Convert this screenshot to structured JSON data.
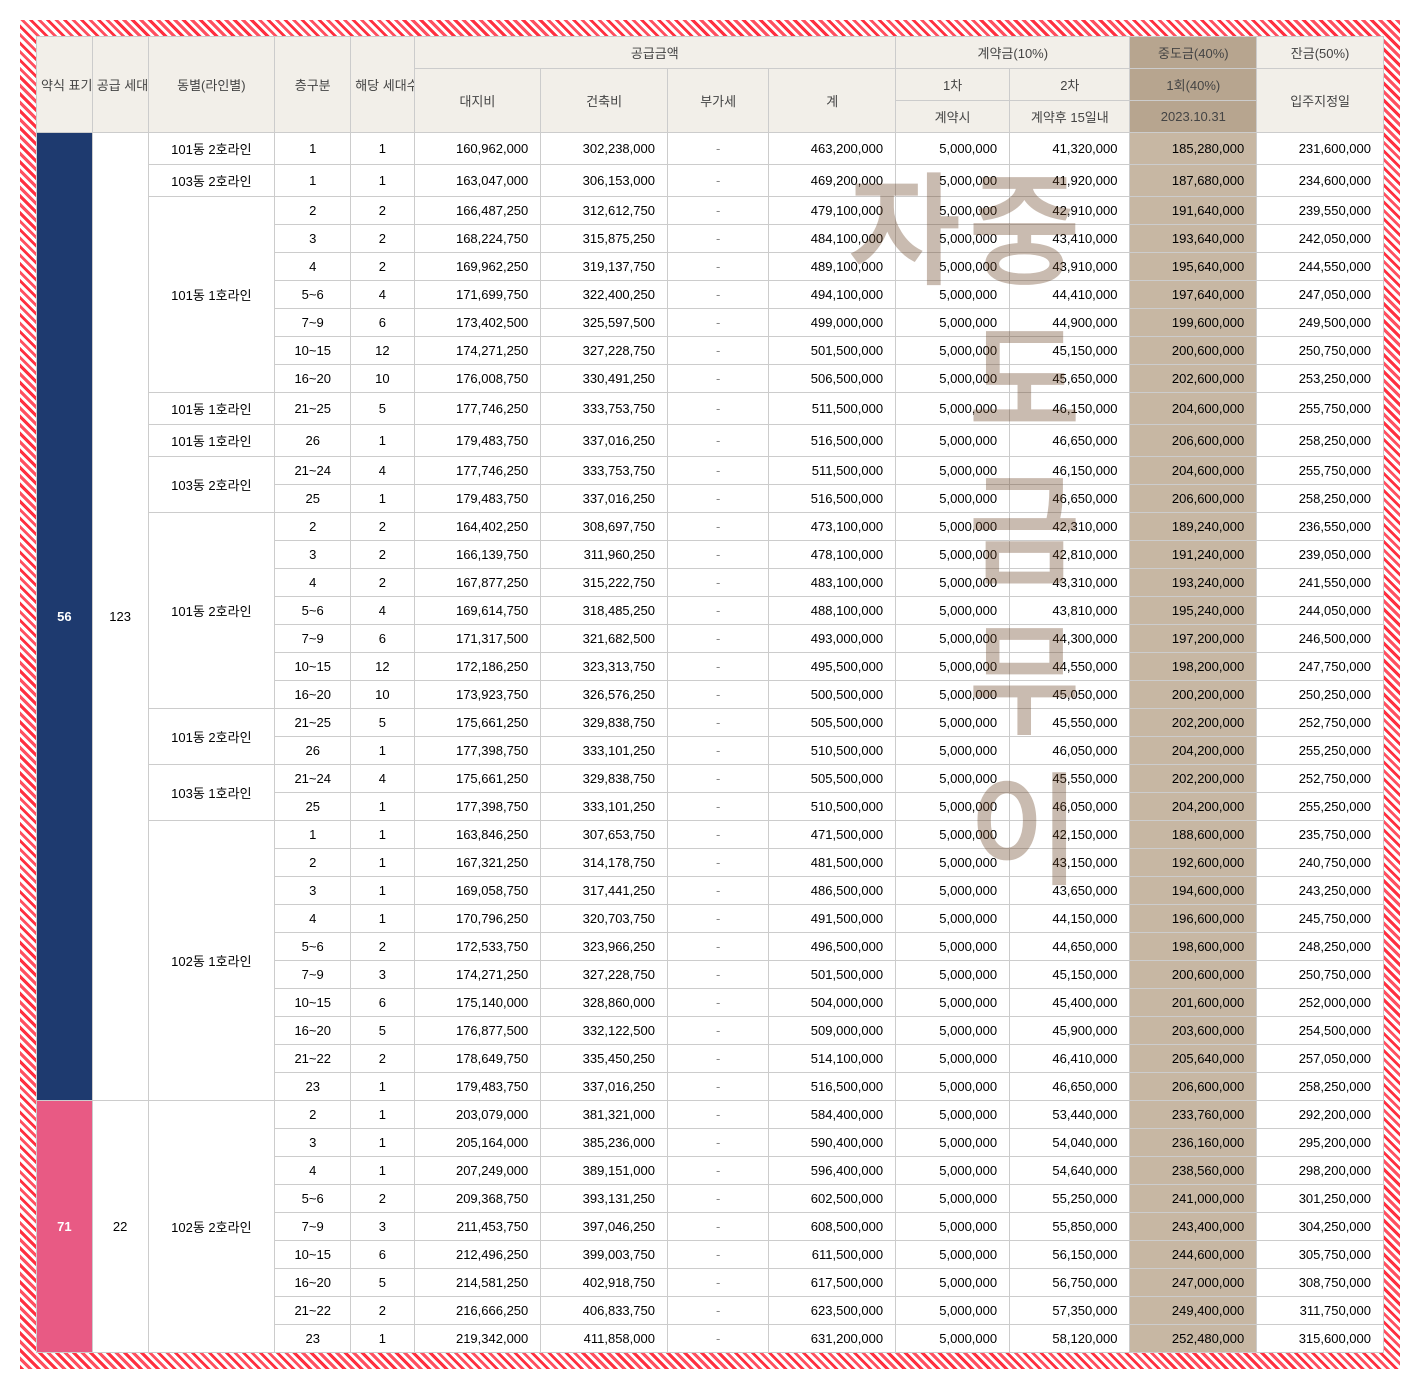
{
  "headers": {
    "type": "약식\n표기",
    "supply_count": "공급\n세대수",
    "building": "동별(라인별)",
    "floor": "층구분",
    "unit_count": "해당\n세대수",
    "supply_amount": "공급금액",
    "land": "대지비",
    "const": "건축비",
    "vat": "부가세",
    "total": "계",
    "contract": "계약금(10%)",
    "c1": "1차",
    "c2": "2차",
    "c1_sub": "계약시",
    "c2_sub": "계약후 15일내",
    "mid": "중도금(40%)",
    "mid_sub1": "1회(40%)",
    "mid_sub2": "2023.10.31",
    "bal": "잔금(50%)",
    "bal_sub": "입주지정일"
  },
  "watermark": "중도금무이자",
  "sections": [
    {
      "type": "56",
      "type_color": "blue",
      "supply": "123",
      "groups": [
        {
          "building": "101동 2호라인",
          "rows": [
            {
              "floor": "1",
              "cnt": "1",
              "land": "160,962,000",
              "const": "302,238,000",
              "vat": "-",
              "total": "463,200,000",
              "c1": "5,000,000",
              "c2": "41,320,000",
              "mid": "185,280,000",
              "bal": "231,600,000"
            }
          ]
        },
        {
          "building": "103동 2호라인",
          "rows": [
            {
              "floor": "1",
              "cnt": "1",
              "land": "163,047,000",
              "const": "306,153,000",
              "vat": "-",
              "total": "469,200,000",
              "c1": "5,000,000",
              "c2": "41,920,000",
              "mid": "187,680,000",
              "bal": "234,600,000"
            }
          ]
        },
        {
          "building": "101동 1호라인",
          "rows": [
            {
              "floor": "2",
              "cnt": "2",
              "land": "166,487,250",
              "const": "312,612,750",
              "vat": "-",
              "total": "479,100,000",
              "c1": "5,000,000",
              "c2": "42,910,000",
              "mid": "191,640,000",
              "bal": "239,550,000"
            },
            {
              "floor": "3",
              "cnt": "2",
              "land": "168,224,750",
              "const": "315,875,250",
              "vat": "-",
              "total": "484,100,000",
              "c1": "5,000,000",
              "c2": "43,410,000",
              "mid": "193,640,000",
              "bal": "242,050,000"
            },
            {
              "floor": "4",
              "cnt": "2",
              "land": "169,962,250",
              "const": "319,137,750",
              "vat": "-",
              "total": "489,100,000",
              "c1": "5,000,000",
              "c2": "43,910,000",
              "mid": "195,640,000",
              "bal": "244,550,000"
            },
            {
              "floor": "5~6",
              "cnt": "4",
              "land": "171,699,750",
              "const": "322,400,250",
              "vat": "-",
              "total": "494,100,000",
              "c1": "5,000,000",
              "c2": "44,410,000",
              "mid": "197,640,000",
              "bal": "247,050,000"
            },
            {
              "floor": "7~9",
              "cnt": "6",
              "land": "173,402,500",
              "const": "325,597,500",
              "vat": "-",
              "total": "499,000,000",
              "c1": "5,000,000",
              "c2": "44,900,000",
              "mid": "199,600,000",
              "bal": "249,500,000"
            },
            {
              "floor": "10~15",
              "cnt": "12",
              "land": "174,271,250",
              "const": "327,228,750",
              "vat": "-",
              "total": "501,500,000",
              "c1": "5,000,000",
              "c2": "45,150,000",
              "mid": "200,600,000",
              "bal": "250,750,000"
            },
            {
              "floor": "16~20",
              "cnt": "10",
              "land": "176,008,750",
              "const": "330,491,250",
              "vat": "-",
              "total": "506,500,000",
              "c1": "5,000,000",
              "c2": "45,650,000",
              "mid": "202,600,000",
              "bal": "253,250,000"
            }
          ]
        },
        {
          "building": "101동 1호라인",
          "rows": [
            {
              "floor": "21~25",
              "cnt": "5",
              "land": "177,746,250",
              "const": "333,753,750",
              "vat": "-",
              "total": "511,500,000",
              "c1": "5,000,000",
              "c2": "46,150,000",
              "mid": "204,600,000",
              "bal": "255,750,000"
            }
          ]
        },
        {
          "building": "101동 1호라인",
          "rows": [
            {
              "floor": "26",
              "cnt": "1",
              "land": "179,483,750",
              "const": "337,016,250",
              "vat": "-",
              "total": "516,500,000",
              "c1": "5,000,000",
              "c2": "46,650,000",
              "mid": "206,600,000",
              "bal": "258,250,000"
            }
          ]
        },
        {
          "building": "103동 2호라인",
          "rows": [
            {
              "floor": "21~24",
              "cnt": "4",
              "land": "177,746,250",
              "const": "333,753,750",
              "vat": "-",
              "total": "511,500,000",
              "c1": "5,000,000",
              "c2": "46,150,000",
              "mid": "204,600,000",
              "bal": "255,750,000"
            },
            {
              "floor": "25",
              "cnt": "1",
              "land": "179,483,750",
              "const": "337,016,250",
              "vat": "-",
              "total": "516,500,000",
              "c1": "5,000,000",
              "c2": "46,650,000",
              "mid": "206,600,000",
              "bal": "258,250,000"
            }
          ]
        },
        {
          "building": "101동 2호라인",
          "rows": [
            {
              "floor": "2",
              "cnt": "2",
              "land": "164,402,250",
              "const": "308,697,750",
              "vat": "-",
              "total": "473,100,000",
              "c1": "5,000,000",
              "c2": "42,310,000",
              "mid": "189,240,000",
              "bal": "236,550,000"
            },
            {
              "floor": "3",
              "cnt": "2",
              "land": "166,139,750",
              "const": "311,960,250",
              "vat": "-",
              "total": "478,100,000",
              "c1": "5,000,000",
              "c2": "42,810,000",
              "mid": "191,240,000",
              "bal": "239,050,000"
            },
            {
              "floor": "4",
              "cnt": "2",
              "land": "167,877,250",
              "const": "315,222,750",
              "vat": "-",
              "total": "483,100,000",
              "c1": "5,000,000",
              "c2": "43,310,000",
              "mid": "193,240,000",
              "bal": "241,550,000"
            },
            {
              "floor": "5~6",
              "cnt": "4",
              "land": "169,614,750",
              "const": "318,485,250",
              "vat": "-",
              "total": "488,100,000",
              "c1": "5,000,000",
              "c2": "43,810,000",
              "mid": "195,240,000",
              "bal": "244,050,000"
            },
            {
              "floor": "7~9",
              "cnt": "6",
              "land": "171,317,500",
              "const": "321,682,500",
              "vat": "-",
              "total": "493,000,000",
              "c1": "5,000,000",
              "c2": "44,300,000",
              "mid": "197,200,000",
              "bal": "246,500,000"
            },
            {
              "floor": "10~15",
              "cnt": "12",
              "land": "172,186,250",
              "const": "323,313,750",
              "vat": "-",
              "total": "495,500,000",
              "c1": "5,000,000",
              "c2": "44,550,000",
              "mid": "198,200,000",
              "bal": "247,750,000"
            },
            {
              "floor": "16~20",
              "cnt": "10",
              "land": "173,923,750",
              "const": "326,576,250",
              "vat": "-",
              "total": "500,500,000",
              "c1": "5,000,000",
              "c2": "45,050,000",
              "mid": "200,200,000",
              "bal": "250,250,000"
            }
          ]
        },
        {
          "building": "101동 2호라인",
          "rows": [
            {
              "floor": "21~25",
              "cnt": "5",
              "land": "175,661,250",
              "const": "329,838,750",
              "vat": "-",
              "total": "505,500,000",
              "c1": "5,000,000",
              "c2": "45,550,000",
              "mid": "202,200,000",
              "bal": "252,750,000"
            },
            {
              "floor": "26",
              "cnt": "1",
              "land": "177,398,750",
              "const": "333,101,250",
              "vat": "-",
              "total": "510,500,000",
              "c1": "5,000,000",
              "c2": "46,050,000",
              "mid": "204,200,000",
              "bal": "255,250,000"
            }
          ]
        },
        {
          "building": "103동 1호라인",
          "rows": [
            {
              "floor": "21~24",
              "cnt": "4",
              "land": "175,661,250",
              "const": "329,838,750",
              "vat": "-",
              "total": "505,500,000",
              "c1": "5,000,000",
              "c2": "45,550,000",
              "mid": "202,200,000",
              "bal": "252,750,000"
            },
            {
              "floor": "25",
              "cnt": "1",
              "land": "177,398,750",
              "const": "333,101,250",
              "vat": "-",
              "total": "510,500,000",
              "c1": "5,000,000",
              "c2": "46,050,000",
              "mid": "204,200,000",
              "bal": "255,250,000"
            }
          ]
        },
        {
          "building": "102동 1호라인",
          "rows": [
            {
              "floor": "1",
              "cnt": "1",
              "land": "163,846,250",
              "const": "307,653,750",
              "vat": "-",
              "total": "471,500,000",
              "c1": "5,000,000",
              "c2": "42,150,000",
              "mid": "188,600,000",
              "bal": "235,750,000"
            },
            {
              "floor": "2",
              "cnt": "1",
              "land": "167,321,250",
              "const": "314,178,750",
              "vat": "-",
              "total": "481,500,000",
              "c1": "5,000,000",
              "c2": "43,150,000",
              "mid": "192,600,000",
              "bal": "240,750,000"
            },
            {
              "floor": "3",
              "cnt": "1",
              "land": "169,058,750",
              "const": "317,441,250",
              "vat": "-",
              "total": "486,500,000",
              "c1": "5,000,000",
              "c2": "43,650,000",
              "mid": "194,600,000",
              "bal": "243,250,000"
            },
            {
              "floor": "4",
              "cnt": "1",
              "land": "170,796,250",
              "const": "320,703,750",
              "vat": "-",
              "total": "491,500,000",
              "c1": "5,000,000",
              "c2": "44,150,000",
              "mid": "196,600,000",
              "bal": "245,750,000"
            },
            {
              "floor": "5~6",
              "cnt": "2",
              "land": "172,533,750",
              "const": "323,966,250",
              "vat": "-",
              "total": "496,500,000",
              "c1": "5,000,000",
              "c2": "44,650,000",
              "mid": "198,600,000",
              "bal": "248,250,000"
            },
            {
              "floor": "7~9",
              "cnt": "3",
              "land": "174,271,250",
              "const": "327,228,750",
              "vat": "-",
              "total": "501,500,000",
              "c1": "5,000,000",
              "c2": "45,150,000",
              "mid": "200,600,000",
              "bal": "250,750,000"
            },
            {
              "floor": "10~15",
              "cnt": "6",
              "land": "175,140,000",
              "const": "328,860,000",
              "vat": "-",
              "total": "504,000,000",
              "c1": "5,000,000",
              "c2": "45,400,000",
              "mid": "201,600,000",
              "bal": "252,000,000"
            },
            {
              "floor": "16~20",
              "cnt": "5",
              "land": "176,877,500",
              "const": "332,122,500",
              "vat": "-",
              "total": "509,000,000",
              "c1": "5,000,000",
              "c2": "45,900,000",
              "mid": "203,600,000",
              "bal": "254,500,000"
            },
            {
              "floor": "21~22",
              "cnt": "2",
              "land": "178,649,750",
              "const": "335,450,250",
              "vat": "-",
              "total": "514,100,000",
              "c1": "5,000,000",
              "c2": "46,410,000",
              "mid": "205,640,000",
              "bal": "257,050,000"
            },
            {
              "floor": "23",
              "cnt": "1",
              "land": "179,483,750",
              "const": "337,016,250",
              "vat": "-",
              "total": "516,500,000",
              "c1": "5,000,000",
              "c2": "46,650,000",
              "mid": "206,600,000",
              "bal": "258,250,000"
            }
          ]
        }
      ]
    },
    {
      "type": "71",
      "type_color": "pink",
      "supply": "22",
      "groups": [
        {
          "building": "102동 2호라인",
          "rows": [
            {
              "floor": "2",
              "cnt": "1",
              "land": "203,079,000",
              "const": "381,321,000",
              "vat": "-",
              "total": "584,400,000",
              "c1": "5,000,000",
              "c2": "53,440,000",
              "mid": "233,760,000",
              "bal": "292,200,000"
            },
            {
              "floor": "3",
              "cnt": "1",
              "land": "205,164,000",
              "const": "385,236,000",
              "vat": "-",
              "total": "590,400,000",
              "c1": "5,000,000",
              "c2": "54,040,000",
              "mid": "236,160,000",
              "bal": "295,200,000"
            },
            {
              "floor": "4",
              "cnt": "1",
              "land": "207,249,000",
              "const": "389,151,000",
              "vat": "-",
              "total": "596,400,000",
              "c1": "5,000,000",
              "c2": "54,640,000",
              "mid": "238,560,000",
              "bal": "298,200,000"
            },
            {
              "floor": "5~6",
              "cnt": "2",
              "land": "209,368,750",
              "const": "393,131,250",
              "vat": "-",
              "total": "602,500,000",
              "c1": "5,000,000",
              "c2": "55,250,000",
              "mid": "241,000,000",
              "bal": "301,250,000"
            },
            {
              "floor": "7~9",
              "cnt": "3",
              "land": "211,453,750",
              "const": "397,046,250",
              "vat": "-",
              "total": "608,500,000",
              "c1": "5,000,000",
              "c2": "55,850,000",
              "mid": "243,400,000",
              "bal": "304,250,000"
            },
            {
              "floor": "10~15",
              "cnt": "6",
              "land": "212,496,250",
              "const": "399,003,750",
              "vat": "-",
              "total": "611,500,000",
              "c1": "5,000,000",
              "c2": "56,150,000",
              "mid": "244,600,000",
              "bal": "305,750,000"
            },
            {
              "floor": "16~20",
              "cnt": "5",
              "land": "214,581,250",
              "const": "402,918,750",
              "vat": "-",
              "total": "617,500,000",
              "c1": "5,000,000",
              "c2": "56,750,000",
              "mid": "247,000,000",
              "bal": "308,750,000"
            },
            {
              "floor": "21~22",
              "cnt": "2",
              "land": "216,666,250",
              "const": "406,833,750",
              "vat": "-",
              "total": "623,500,000",
              "c1": "5,000,000",
              "c2": "57,350,000",
              "mid": "249,400,000",
              "bal": "311,750,000"
            },
            {
              "floor": "23",
              "cnt": "1",
              "land": "219,342,000",
              "const": "411,858,000",
              "vat": "-",
              "total": "631,200,000",
              "c1": "5,000,000",
              "c2": "58,120,000",
              "mid": "252,480,000",
              "bal": "315,600,000"
            }
          ]
        }
      ]
    }
  ]
}
